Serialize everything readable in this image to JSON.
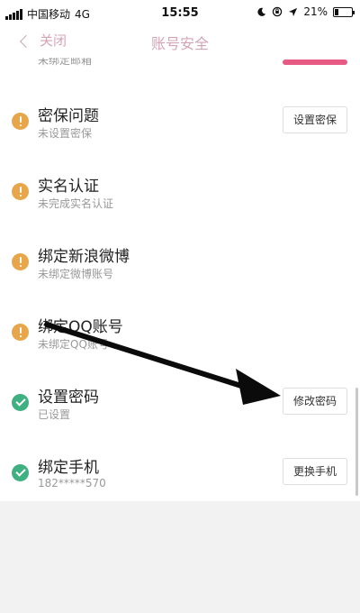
{
  "status_bar": {
    "carrier": "中国移动",
    "network": "4G",
    "time": "15:55",
    "battery_text": "21%",
    "battery_level": 0.21,
    "icons": [
      "moon-icon",
      "lock-rotation-icon",
      "location-icon"
    ]
  },
  "nav": {
    "back_label": "关闭",
    "title": "账号安全"
  },
  "partial_item": {
    "sub": "未绑定邮箱"
  },
  "items": [
    {
      "title": "密保问题",
      "sub": "未设置密保",
      "status": "warning",
      "action": "设置密保"
    },
    {
      "title": "实名认证",
      "sub": "未完成实名认证",
      "status": "warning",
      "action": ""
    },
    {
      "title": "绑定新浪微博",
      "sub": "未绑定微博账号",
      "status": "warning",
      "action": ""
    },
    {
      "title": "绑定QQ账号",
      "sub": "未绑定QQ账号",
      "status": "warning",
      "action": ""
    },
    {
      "title": "设置密码",
      "sub": "已设置",
      "status": "ok",
      "action": "修改密码"
    },
    {
      "title": "绑定手机",
      "sub": "182*****570",
      "status": "ok",
      "action": "更换手机"
    }
  ],
  "colors": {
    "accent": "#d4a4b4",
    "warning": "#e8a64a",
    "ok": "#3fb081",
    "pink_bar": "#e65a83"
  }
}
